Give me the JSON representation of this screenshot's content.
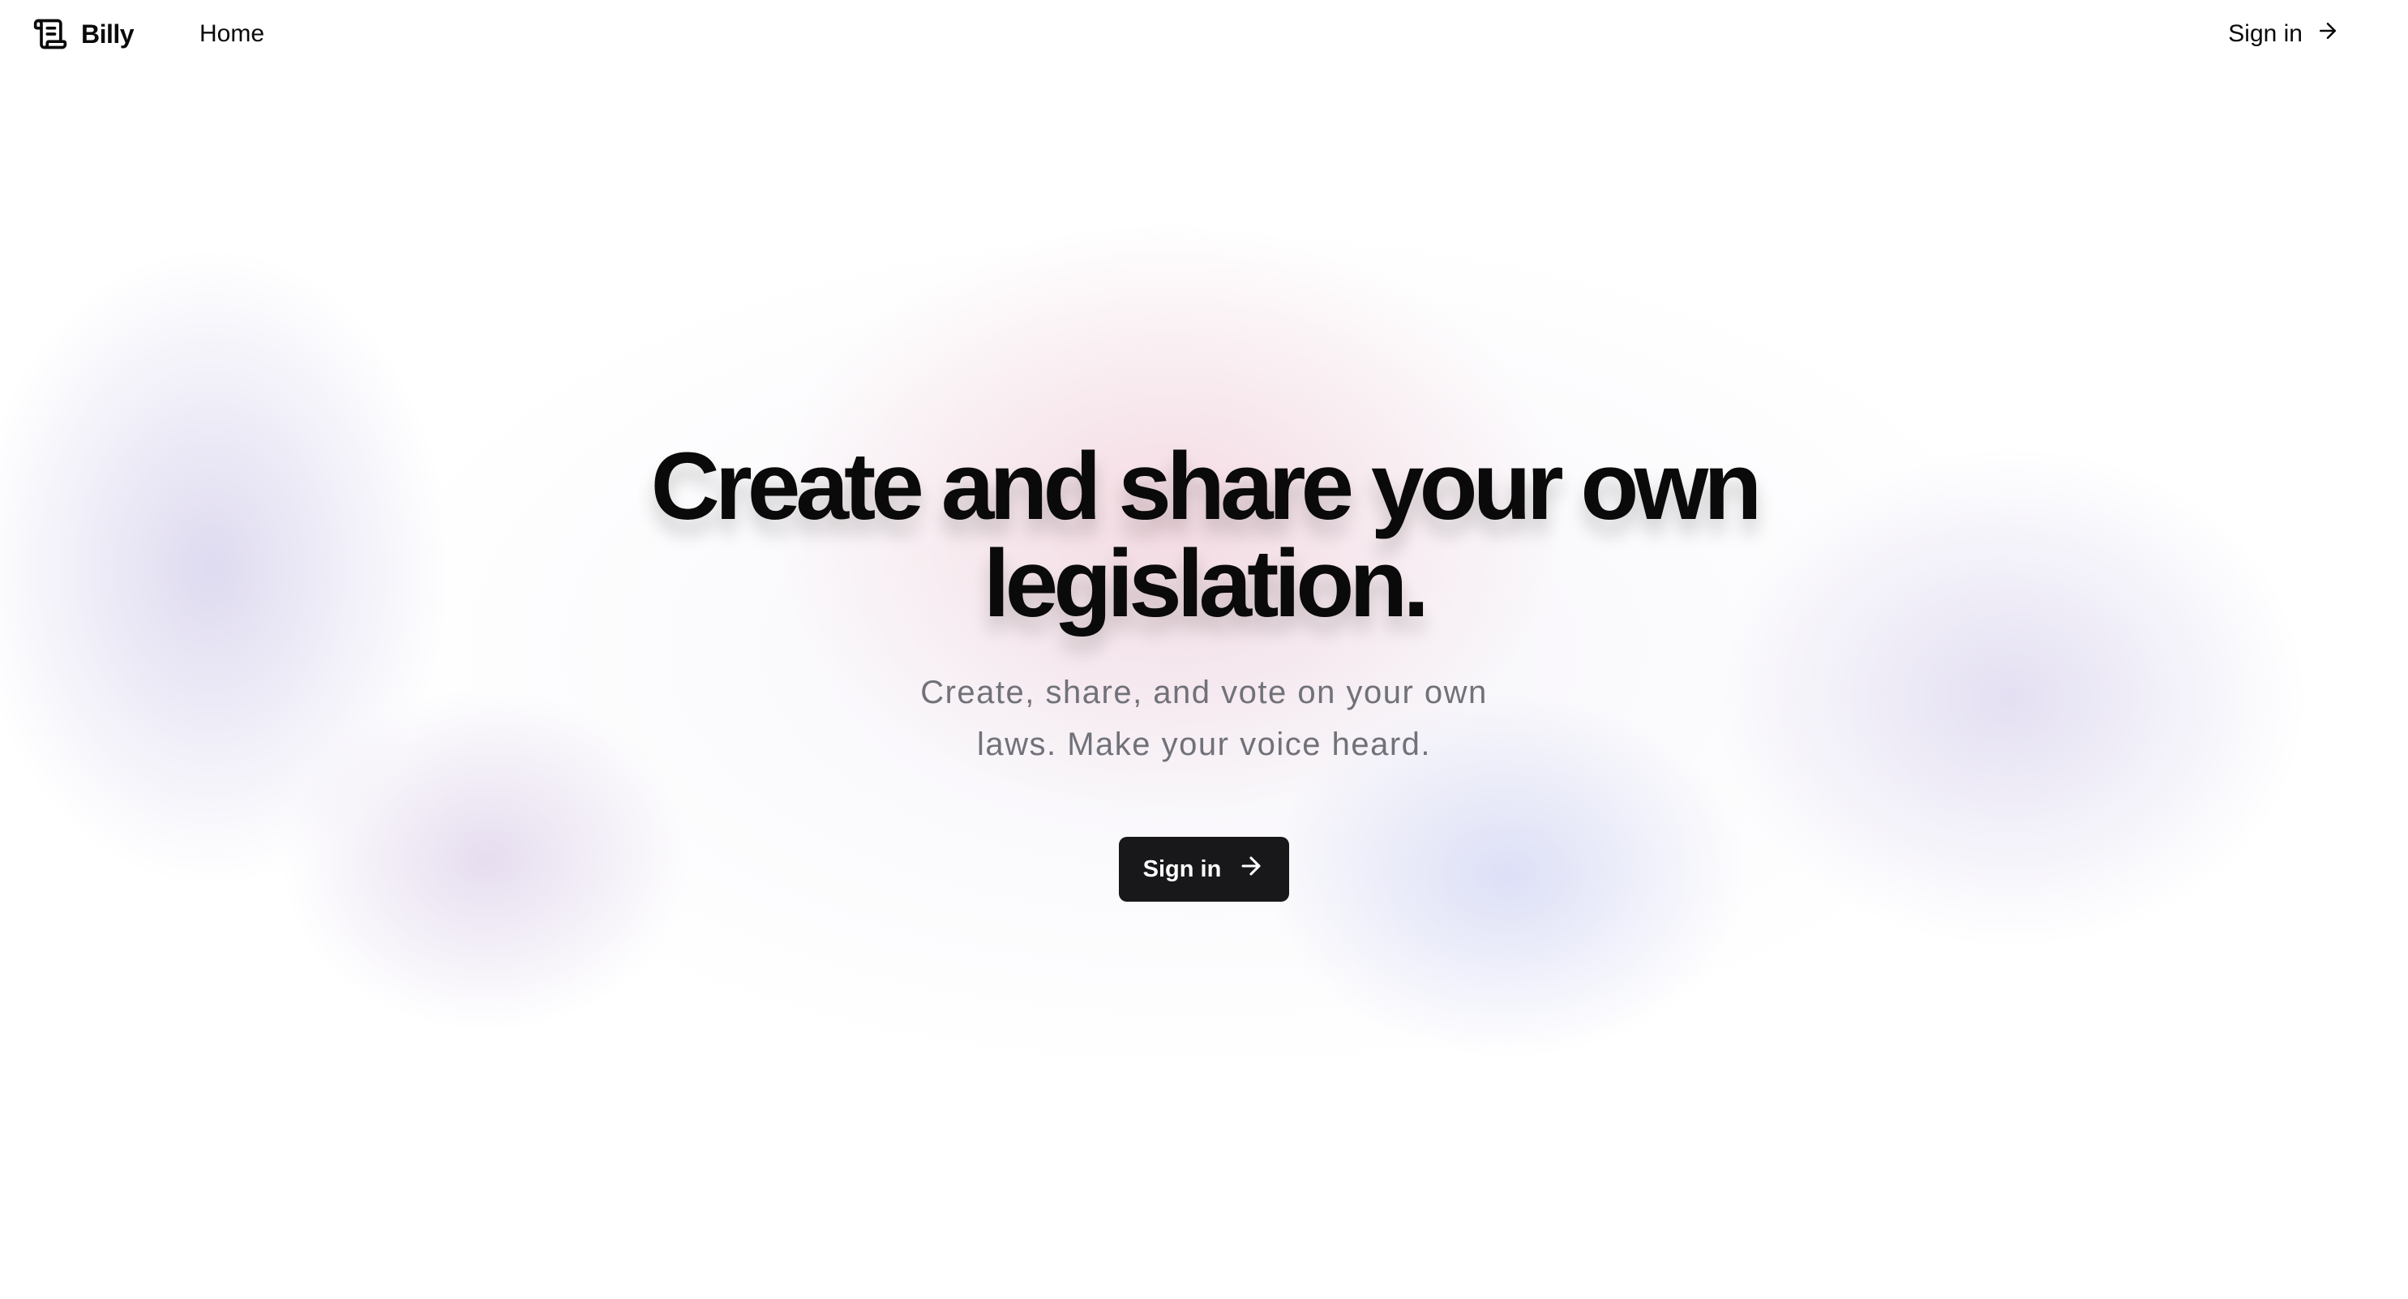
{
  "nav": {
    "brand": "Billy",
    "home": "Home",
    "signin": "Sign in",
    "logo_icon": "scroll-icon",
    "arrow_icon": "arrow-right-icon"
  },
  "hero": {
    "headline": "Create and share your own legislation.",
    "subtitle": "Create, share, and vote on your own laws. Make your voice heard.",
    "cta_label": "Sign in",
    "cta_icon": "arrow-right-icon"
  },
  "colors": {
    "text": "#0a0a0a",
    "muted": "#71717a",
    "button_bg": "#18181b",
    "button_text": "#ffffff",
    "background": "#ffffff"
  }
}
